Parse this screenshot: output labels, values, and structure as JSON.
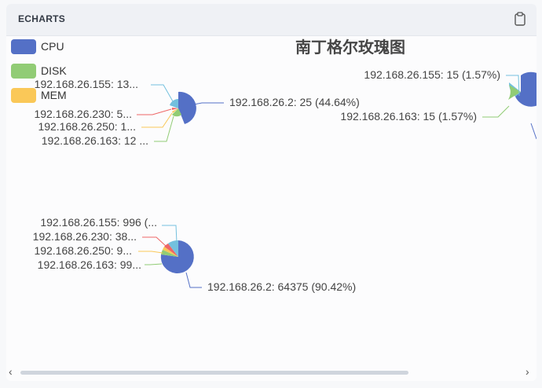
{
  "panel": {
    "title": "ECHARTS"
  },
  "icons": {
    "clipboard": "clipboard-icon",
    "scroll_left": "chevron-left-icon",
    "scroll_right": "chevron-right-icon"
  },
  "scroll": {
    "left": "‹",
    "right": "›"
  },
  "chart_data": {
    "type": "pie",
    "title": "南丁格尔玫瑰图",
    "legend": {
      "placement": "top-left",
      "entries": [
        {
          "name": "CPU",
          "color": "#5470c6"
        },
        {
          "name": "DISK",
          "color": "#91cc75"
        },
        {
          "name": "MEM",
          "color": "#fac858"
        }
      ]
    },
    "slice_colors": [
      "#5470c6",
      "#91cc75",
      "#fac858",
      "#ee6666",
      "#73c0de"
    ],
    "pies": [
      {
        "series": "CPU",
        "slices": [
          {
            "name": "192.168.26.2",
            "label": "192.168.26.2: 25 (44.64%)",
            "percent": 44.64,
            "color": "#5470c6"
          },
          {
            "name": "192.168.26.163",
            "label": "192.168.26.163: 12 ...",
            "color": "#91cc75"
          },
          {
            "name": "192.168.26.250",
            "label": "192.168.26.250: 1...",
            "color": "#fac858"
          },
          {
            "name": "192.168.26.230",
            "label": "192.168.26.230: 5...",
            "color": "#ee6666"
          },
          {
            "name": "192.168.26.155",
            "label": "192.168.26.155: 13...",
            "color": "#73c0de"
          }
        ]
      },
      {
        "series": "DISK",
        "slices": [
          {
            "name": "192.168.26.155",
            "label": "192.168.26.155: 15 (1.57%)",
            "value": 15,
            "percent": 1.57,
            "color": "#73c0de"
          },
          {
            "name": "192.168.26.163",
            "label": "192.168.26.163: 15 (1.57%)",
            "value": 15,
            "percent": 1.57,
            "color": "#91cc75"
          }
        ]
      },
      {
        "series": "MEM",
        "slices": [
          {
            "name": "192.168.26.2",
            "label": "192.168.26.2: 64375 (90.42%)",
            "value": 64375,
            "percent": 90.42,
            "color": "#5470c6"
          },
          {
            "name": "192.168.26.163",
            "label": "192.168.26.163: 99...",
            "color": "#91cc75"
          },
          {
            "name": "192.168.26.250",
            "label": "192.168.26.250: 9...",
            "color": "#fac858"
          },
          {
            "name": "192.168.26.230",
            "label": "192.168.26.230: 38...",
            "color": "#ee6666"
          },
          {
            "name": "192.168.26.155",
            "label": "192.168.26.155: 996 (...",
            "color": "#73c0de"
          }
        ]
      }
    ]
  }
}
